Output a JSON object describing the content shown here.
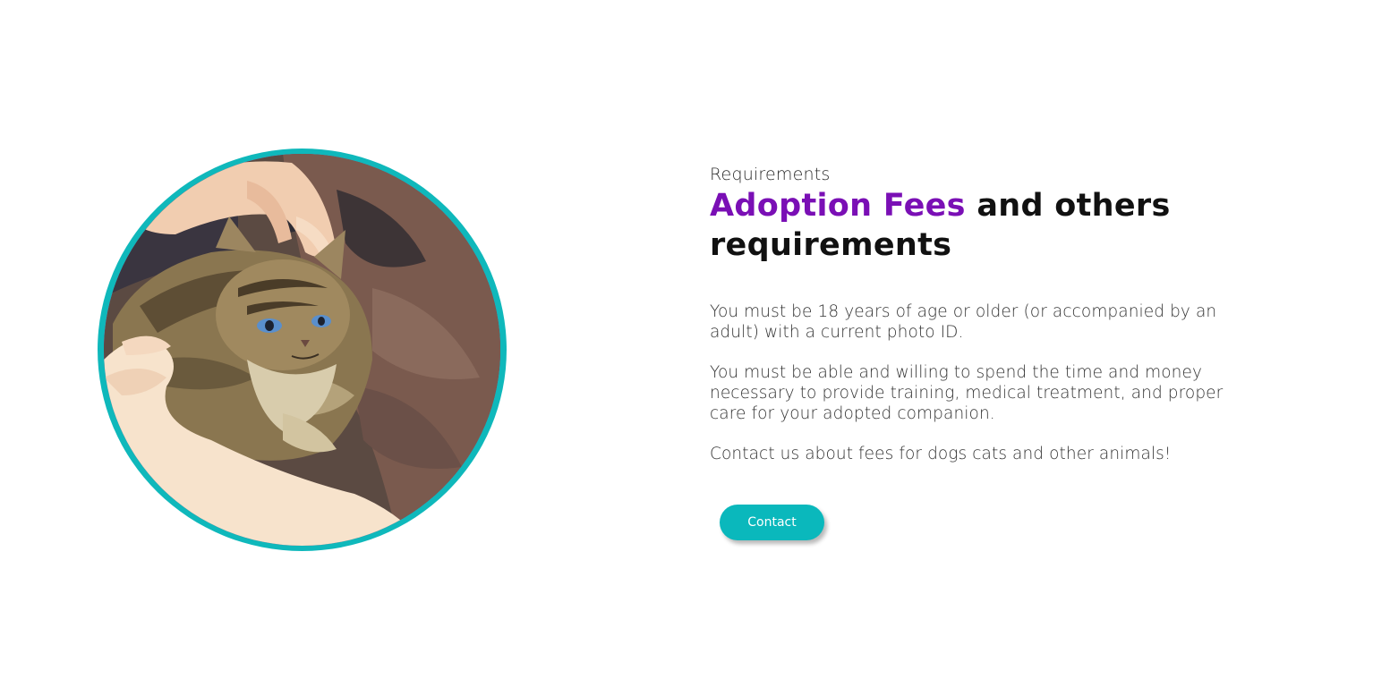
{
  "image": {
    "alt": "Kitten being petted",
    "semantic": "kitten-photo"
  },
  "section": {
    "eyebrow": "Requirements",
    "heading_accent": "Adoption Fees",
    "heading_rest": " and others requirements",
    "paragraphs": [
      "You must be 18 years of age or older (or accompanied by an adult) with a current photo ID.",
      "You must be able and willing to spend the time and money necessary to provide training, medical treatment, and proper care for your adopted companion.",
      "Contact us about fees for dogs cats and other animals!"
    ],
    "button_label": "Contact"
  },
  "colors": {
    "accent_purple": "#7a0fb5",
    "teal": "#0ab8bc",
    "heading_dark": "#111111",
    "body_text": "#333333"
  }
}
